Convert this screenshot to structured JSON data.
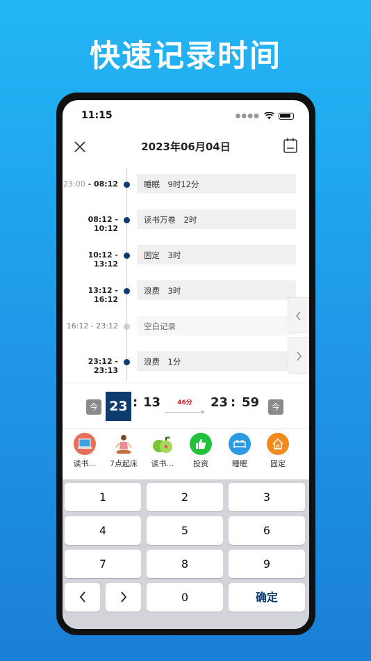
{
  "headline": "快速记录时间",
  "status": {
    "time": "11:15"
  },
  "nav": {
    "title": "2023年06月04日"
  },
  "timeline": [
    {
      "start": "23:00",
      "end": "08:12",
      "label": "睡眠　9时12分",
      "start_gray": true,
      "empty": false
    },
    {
      "start": "08:12",
      "end": "10:12",
      "label": "读书万卷　2时",
      "start_gray": false,
      "empty": false
    },
    {
      "start": "10:12",
      "end": "13:12",
      "label": "固定　3时",
      "start_gray": false,
      "empty": false
    },
    {
      "start": "13:12",
      "end": "16:12",
      "label": "浪费　3时",
      "start_gray": false,
      "empty": false
    },
    {
      "start": "16:12",
      "end": "23:12",
      "label": "空白记录",
      "start_gray": false,
      "empty": true
    },
    {
      "start": "23:12",
      "end": "23:13",
      "label": "浪费　1分",
      "start_gray": false,
      "empty": false
    }
  ],
  "picker": {
    "now_label": "今",
    "start_hour": "23",
    "start_minute": "13",
    "duration": "46分",
    "end_hour": "23",
    "end_minute": "59",
    "colon": ":"
  },
  "categories": [
    {
      "label": "读书…",
      "icon": "laptop-icon",
      "color": "#e7705a"
    },
    {
      "label": "7点起床",
      "icon": "meditation-icon",
      "color": "#ffffff"
    },
    {
      "label": "读书…",
      "icon": "pear-icon",
      "color": "#ffffff"
    },
    {
      "label": "投资",
      "icon": "thumbs-up-icon",
      "color": "#22c13c"
    },
    {
      "label": "睡眠",
      "icon": "bed-icon",
      "color": "#2a9ae4"
    },
    {
      "label": "固定",
      "icon": "house-icon",
      "color": "#f08a1c"
    }
  ],
  "keypad": {
    "keys": [
      "1",
      "2",
      "3",
      "4",
      "5",
      "6",
      "7",
      "8",
      "9"
    ],
    "zero": "0",
    "confirm": "确定"
  },
  "colors": {
    "accent": "#0d3b6e",
    "background": "#22b6f5"
  }
}
